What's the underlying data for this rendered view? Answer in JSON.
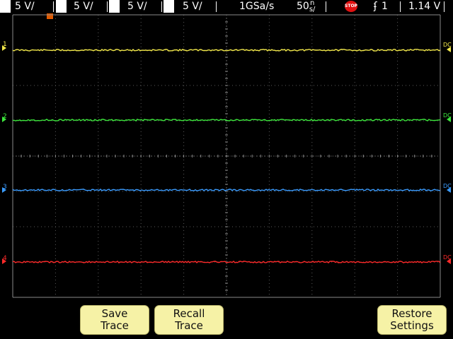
{
  "status_bar": {
    "channels": [
      {
        "id": "1",
        "scale": "5 V/",
        "color": "#f2e84a"
      },
      {
        "id": "2",
        "scale": "5 V/",
        "color": "#3ce63c"
      },
      {
        "id": "3",
        "scale": "5 V/",
        "color": "#3b9cff"
      },
      {
        "id": "4",
        "scale": "5 V/",
        "color": "#ff2a2a"
      }
    ],
    "sample_rate": "1GSa/s",
    "timebase_value": "50",
    "timebase_unit_top": "n",
    "timebase_unit_bottom": "s/",
    "run_state": "STOP",
    "trigger_slope": "ʄ",
    "trigger_source": "1",
    "trigger_level": "1.14 V"
  },
  "trace_labels": {
    "ch1": "1",
    "ch2": "2",
    "ch3": "3",
    "ch4": "4",
    "coupling": "DC",
    "trigger_marker": "T"
  },
  "softkeys": {
    "save_trace_line1": "Save",
    "save_trace_line2": "Trace",
    "recall_trace_line1": "Recall",
    "recall_trace_line2": "Trace",
    "restore_line1": "Restore",
    "restore_line2": "Settings"
  },
  "icons": {
    "run_state": "stop-icon",
    "trigger": "trigger-edge-icon"
  }
}
